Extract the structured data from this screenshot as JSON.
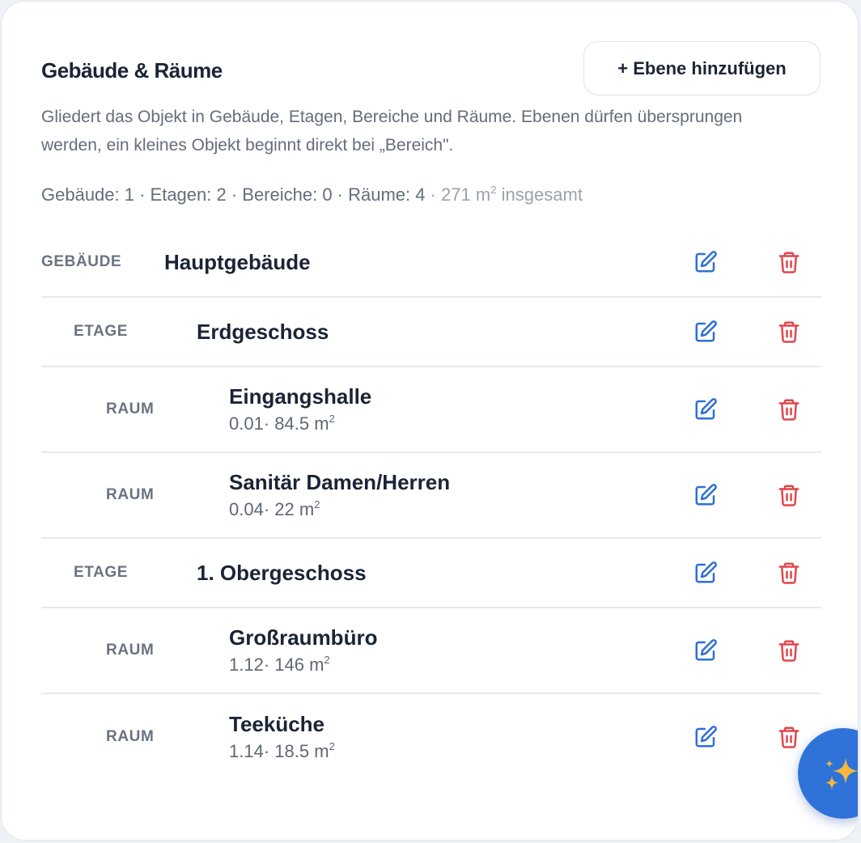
{
  "section": {
    "title": "Gebäude & Räume",
    "add_button_label": "+ Ebene hinzufügen",
    "description": "Gliedert das Objekt in Gebäude, Etagen, Bereiche und Räume. Ebenen dürfen übersprungen werden, ein kleines Objekt beginnt direkt bei „Bereich\".",
    "stats": {
      "counts": "Gebäude: 1 · Etagen: 2 · Bereiche: 0 · Räume: 4",
      "area_prefix": " · 271 m",
      "area_sup": "2",
      "area_suffix": " insgesamt"
    }
  },
  "tree": [
    {
      "level": "GEBÄUDE",
      "name": "Hauptgebäude",
      "depth": 0
    },
    {
      "level": "ETAGE",
      "name": "Erdgeschoss",
      "depth": 1
    },
    {
      "level": "RAUM",
      "name": "Eingangshalle",
      "depth": 2,
      "meta": "0.01· 84.5 m",
      "meta_sup": "2"
    },
    {
      "level": "RAUM",
      "name": "Sanitär Damen/Herren",
      "depth": 2,
      "meta": "0.04· 22 m",
      "meta_sup": "2"
    },
    {
      "level": "ETAGE",
      "name": "1. Obergeschoss",
      "depth": 1
    },
    {
      "level": "RAUM",
      "name": "Großraumbüro",
      "depth": 2,
      "meta": "1.12· 146 m",
      "meta_sup": "2"
    },
    {
      "level": "RAUM",
      "name": "Teeküche",
      "depth": 2,
      "meta": "1.14· 18.5 m",
      "meta_sup": "2"
    }
  ],
  "icons": {
    "edit": "edit-icon",
    "delete": "trash-icon",
    "fab": "sparkles-icon"
  },
  "colors": {
    "edit": "#2f6fd6",
    "delete": "#e0474c",
    "fab": "#2f73d9",
    "sparkle": "#f6b73c"
  }
}
